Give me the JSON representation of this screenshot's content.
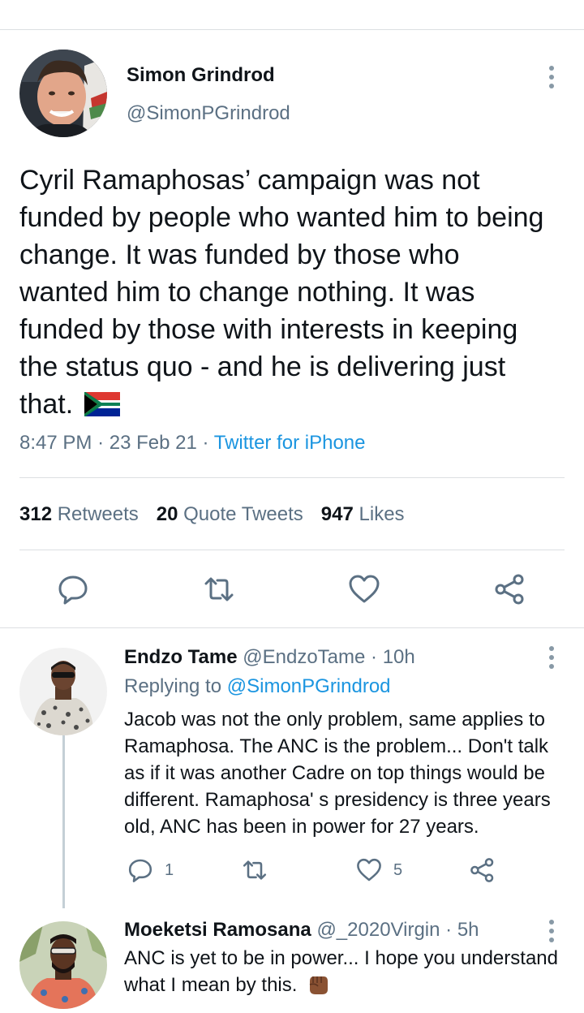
{
  "main_tweet": {
    "author_name": "Simon Grindrod",
    "author_handle": "@SimonPGrindrod",
    "text": "Cyril Ramaphosas’ campaign was not funded by people who wanted him to being change. It was funded by those who wanted him to change nothing. It was funded by those with interests in keeping the status quo - and he is delivering just that.",
    "time": "8:47 PM",
    "date": "23 Feb 21",
    "source": "Twitter for iPhone",
    "stats": {
      "retweets_count": "312",
      "retweets_label": "Retweets",
      "quotes_count": "20",
      "quotes_label": "Quote Tweets",
      "likes_count": "947",
      "likes_label": "Likes"
    },
    "actions": [
      "reply-icon",
      "retweet-icon",
      "like-icon",
      "share-icon"
    ]
  },
  "replies": [
    {
      "name": "Endzo Tame",
      "handle": "@EndzoTame",
      "time": "10h",
      "replying_prefix": "Replying to",
      "replying_handle": "@SimonPGrindrod",
      "text": "Jacob was not the only problem, same applies to Ramaphosa. The ANC is the problem... Don't talk as if it was another Cadre on top things would be different. Ramaphosa' s presidency is three years old, ANC has been in power for 27 years.",
      "reply_count": "1",
      "like_count": "5"
    },
    {
      "name": "Moeketsi Ramosana",
      "handle": "@_2020Virgin",
      "time": "5h",
      "text": "ANC is yet to be in power... I hope you understand what I mean by this."
    }
  ],
  "colors": {
    "text": "#0f1419",
    "secondary": "#5b7083",
    "link": "#1b95e0",
    "divider": "#dcdfe2"
  }
}
